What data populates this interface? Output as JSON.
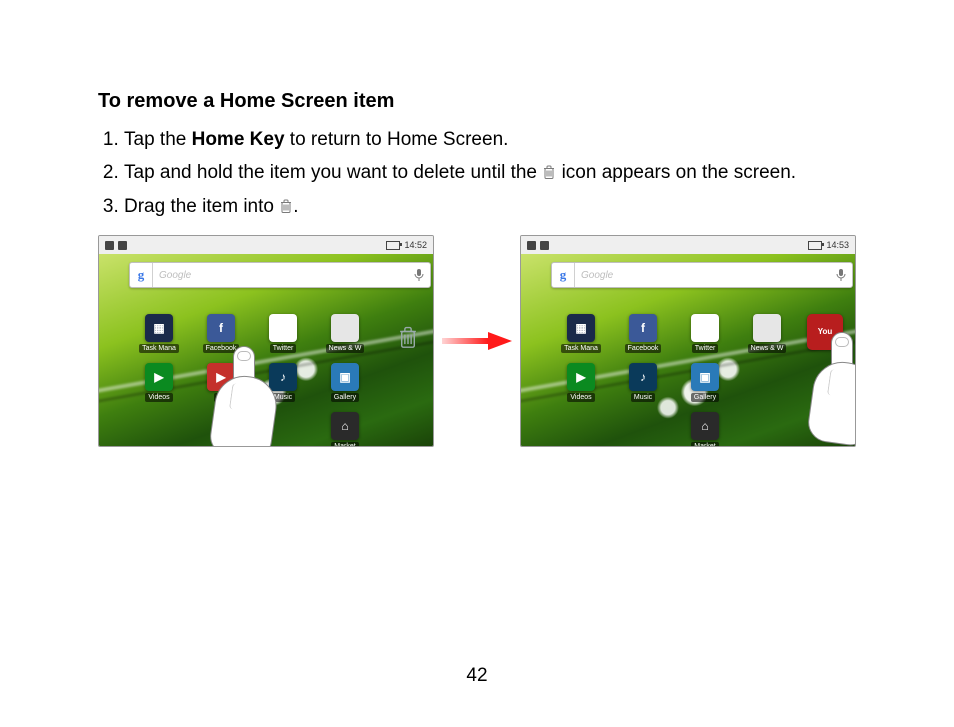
{
  "heading": "To remove a Home Screen item",
  "steps": {
    "s1_a": "Tap the ",
    "s1_bold": "Home Key",
    "s1_b": " to return to Home Screen.",
    "s2_a": "Tap and hold the item you want to delete until the ",
    "s2_b": " icon appears on the screen.",
    "s3_a": "Drag the item into ",
    "s3_b": "."
  },
  "page_number": "42",
  "screenshots": {
    "left": {
      "time": "14:52",
      "search_placeholder": "Google",
      "apps": {
        "row1": [
          {
            "label": "Task Mana",
            "cls": "ico-task",
            "glyph": "▦"
          },
          {
            "label": "Facebook",
            "cls": "ico-fb",
            "glyph": "f"
          },
          {
            "label": "Twitter",
            "cls": "ico-tw",
            "glyph": "t"
          },
          {
            "label": "News & W",
            "cls": "ico-news",
            "glyph": ""
          }
        ],
        "row2": [
          {
            "label": "Videos",
            "cls": "ico-vid",
            "glyph": "▶"
          },
          {
            "label": "Yo",
            "cls": "ico-yt",
            "glyph": "▶"
          },
          {
            "label": "Music",
            "cls": "ico-music",
            "glyph": "♪"
          },
          {
            "label": "Gallery",
            "cls": "ico-gal",
            "glyph": "▣"
          }
        ],
        "row3": [
          {
            "label": "Market",
            "cls": "ico-market",
            "glyph": "⌂"
          }
        ]
      }
    },
    "right": {
      "time": "14:53",
      "search_placeholder": "Google",
      "apps": {
        "row1": [
          {
            "label": "Task Mana",
            "cls": "ico-task",
            "glyph": "▦"
          },
          {
            "label": "Facebook",
            "cls": "ico-fb",
            "glyph": "f"
          },
          {
            "label": "Twitter",
            "cls": "ico-tw",
            "glyph": "t"
          },
          {
            "label": "News & W",
            "cls": "ico-news",
            "glyph": ""
          }
        ],
        "row2": [
          {
            "label": "Videos",
            "cls": "ico-vid",
            "glyph": "▶"
          },
          {
            "label": "Music",
            "cls": "ico-music",
            "glyph": "♪"
          },
          {
            "label": "Gallery",
            "cls": "ico-gal",
            "glyph": "▣"
          }
        ],
        "row3": [
          {
            "label": "Market",
            "cls": "ico-market",
            "glyph": "⌂"
          }
        ]
      },
      "dragged_label": "You"
    }
  }
}
